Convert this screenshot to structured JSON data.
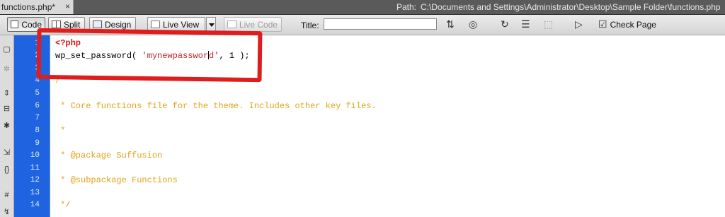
{
  "tab": {
    "label": "functions.php*",
    "close": "×"
  },
  "path": {
    "label": "Path:",
    "value": "C:\\Documents and Settings\\Administrator\\Desktop\\Sample Folder\\functions.php"
  },
  "toolbar": {
    "code": "Code",
    "split": "Split",
    "design": "Design",
    "live_view": "Live View",
    "live_code": "Live Code",
    "title_label": "Title:",
    "title_value": "",
    "check_page": "Check Page"
  },
  "gutter": {
    "lines": [
      "1",
      "2",
      "3",
      "4",
      "5",
      "6",
      "7",
      "8",
      "9",
      "10",
      "11",
      "12",
      "13",
      "14"
    ]
  },
  "code": {
    "line1": "<?php",
    "line2_fn": "wp_set_password( ",
    "line2_str_a": "'mynewpasswor",
    "line2_str_b": "d'",
    "line2_rest": ", 1 );",
    "line4": "/**",
    "line6": " * Core functions file for the theme. Includes other key files.",
    "line8": " *",
    "line10": " * @package Suffusion",
    "line12": " * @subpackage Functions",
    "line14": " */"
  },
  "accent": {
    "gutter": "#1f63e0",
    "annotation": "#e01c1c",
    "comment": "#e3a21a"
  }
}
